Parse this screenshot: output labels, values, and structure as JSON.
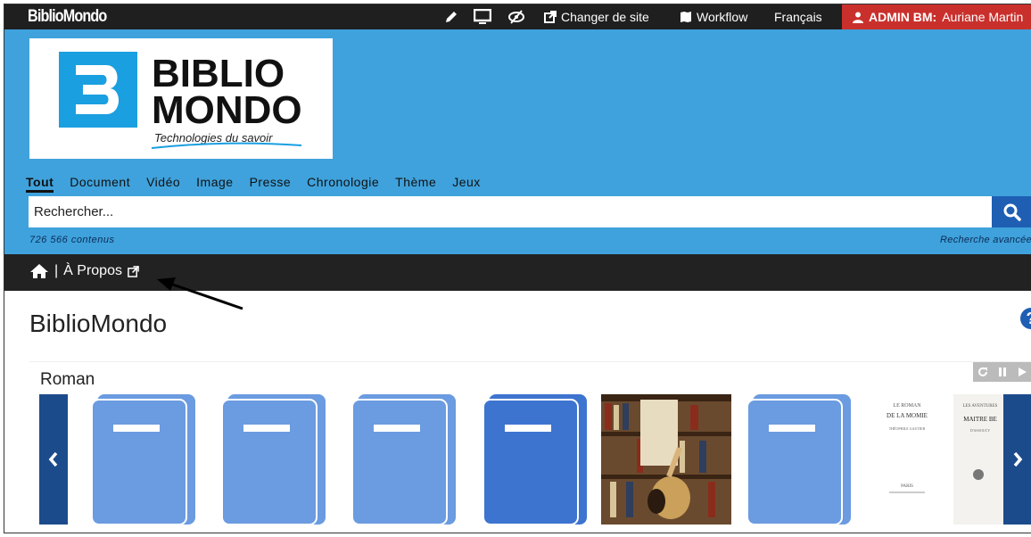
{
  "topbar": {
    "brand": "BiblioMondo",
    "changer_site": "Changer de site",
    "workflow": "Workflow",
    "language": "Français",
    "admin_label": "ADMIN BM:",
    "admin_user": "Auriane Martin",
    "icons": [
      "pencil-icon",
      "monitor-icon",
      "eye-slash-icon",
      "external-link-icon",
      "map-icon",
      "user-icon"
    ]
  },
  "logo": {
    "line1": "BIBLIO",
    "line2": "MONDO",
    "tagline": "Technologies du savoir"
  },
  "nav": {
    "items": [
      "Tout",
      "Document",
      "Vidéo",
      "Image",
      "Presse",
      "Chronologie",
      "Thème",
      "Jeux"
    ],
    "active": "Tout"
  },
  "search": {
    "placeholder": "Rechercher...",
    "count": "726 566 contenus",
    "advanced": "Recherche avancée"
  },
  "breadcrumb": {
    "separator": "|",
    "link": "À Propos"
  },
  "main": {
    "title": "BiblioMondo",
    "help": "?"
  },
  "carousel": {
    "title": "Roman",
    "items": [
      {
        "kind": "book-placeholder"
      },
      {
        "kind": "book-placeholder"
      },
      {
        "kind": "book-placeholder"
      },
      {
        "kind": "book-placeholder-dark"
      },
      {
        "kind": "photo-bookshelf"
      },
      {
        "kind": "book-placeholder"
      },
      {
        "kind": "scan",
        "lines": [
          "LE ROMAN",
          "DE LA MOMIE",
          "THÉOPHILE GAUTIER",
          "PARIS"
        ]
      },
      {
        "kind": "scan",
        "lines": [
          "LES AVENTURES",
          "MAITRE BE",
          "D'ASSOUCY"
        ]
      }
    ]
  },
  "colors": {
    "header_blue": "#3fa2dc",
    "topbar": "#1f1f1f",
    "admin_red": "#c9302c",
    "book_light": "#6b9be0",
    "book_dark": "#3d74cf",
    "arrow_navy": "#1c4b8c"
  }
}
